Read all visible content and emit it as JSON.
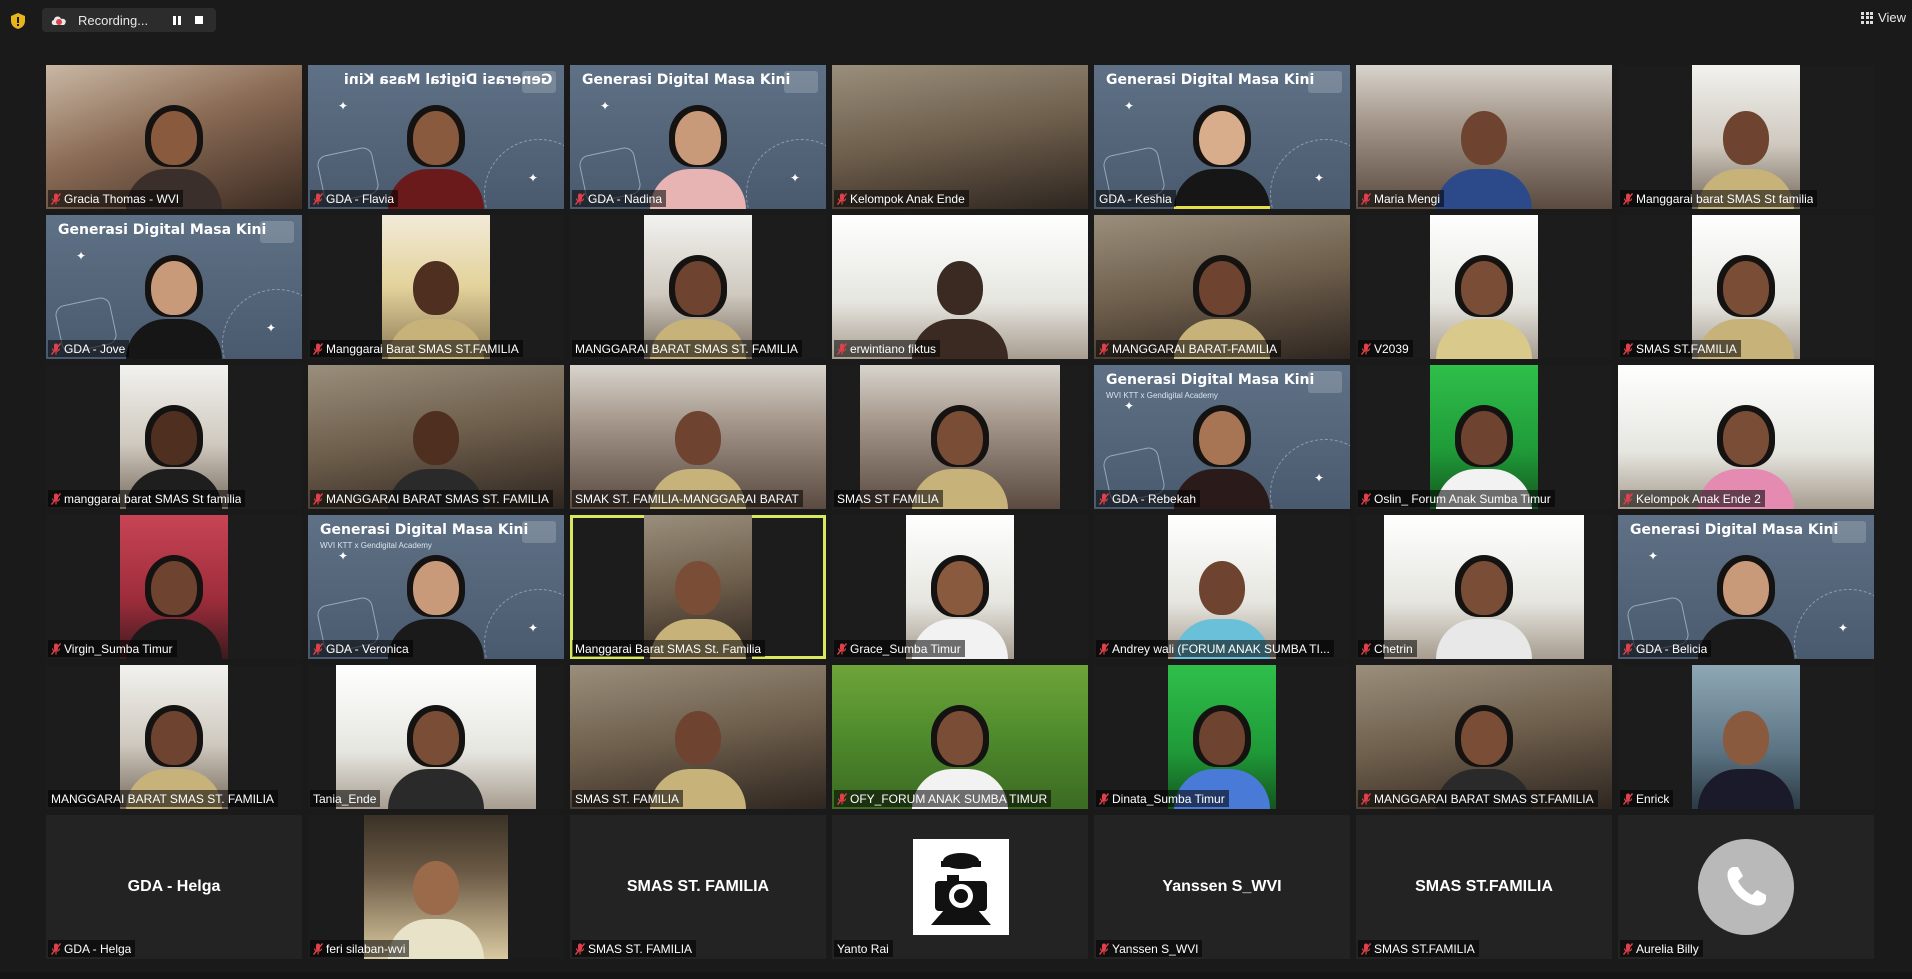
{
  "topbar": {
    "recording_label": "Recording...",
    "view_label": "View"
  },
  "colors": {
    "background": "#1a1a1a",
    "tile": "#1c1c1c",
    "active_speaker": "#d9e85c",
    "muted_icon": "#e0404a",
    "gda_bg": "#56687c"
  },
  "gda_banner": {
    "title": "Generasi Digital Masa Kini",
    "sub": "WVI KTT x Gendigital Academy"
  },
  "tiles": [
    {
      "name": "Gracia Thomas - WVI",
      "muted": true
    },
    {
      "name": "GDA - Flavia",
      "muted": true
    },
    {
      "name": "GDA - Nadina",
      "muted": true
    },
    {
      "name": "Kelompok Anak Ende",
      "muted": true
    },
    {
      "name": "GDA - Keshia",
      "muted": false
    },
    {
      "name": "Maria Mengi",
      "muted": true
    },
    {
      "name": "Manggarai barat SMAS St familia",
      "muted": true
    },
    {
      "name": "GDA - Jove",
      "muted": true
    },
    {
      "name": "Manggarai Barat SMAS ST.FAMILIA",
      "muted": true
    },
    {
      "name": "MANGGARAI BARAT SMAS ST. FAMILIA",
      "muted": false
    },
    {
      "name": "erwintiano fiktus",
      "muted": true
    },
    {
      "name": "MANGGARAI BARAT-FAMILIA",
      "muted": true
    },
    {
      "name": "V2039",
      "muted": true
    },
    {
      "name": "SMAS ST.FAMILIA",
      "muted": true
    },
    {
      "name": "manggarai barat SMAS St familia",
      "muted": true
    },
    {
      "name": "MANGGARAI BARAT SMAS ST. FAMILIA",
      "muted": true
    },
    {
      "name": "SMAK ST. FAMILIA-MANGGARAI BARAT",
      "muted": false
    },
    {
      "name": "SMAS ST FAMILIA",
      "muted": false
    },
    {
      "name": "GDA - Rebekah",
      "muted": true
    },
    {
      "name": "Oslin_ Forum Anak Sumba Timur",
      "muted": true
    },
    {
      "name": "Kelompok Anak Ende 2",
      "muted": true
    },
    {
      "name": "Virgin_Sumba Timur",
      "muted": true
    },
    {
      "name": "GDA - Veronica",
      "muted": true
    },
    {
      "name": "Manggarai Barat SMAS St. Familia",
      "muted": false
    },
    {
      "name": "Grace_Sumba Timur",
      "muted": true
    },
    {
      "name": "Andrey wali (FORUM ANAK SUMBA TI...",
      "muted": true
    },
    {
      "name": "Chetrin",
      "muted": true
    },
    {
      "name": "GDA - Belicia",
      "muted": true
    },
    {
      "name": "MANGGARAI BARAT SMAS ST. FAMILIA",
      "muted": false
    },
    {
      "name": "Tania_Ende",
      "muted": false
    },
    {
      "name": "SMAS ST. FAMILIA",
      "muted": false
    },
    {
      "name": "OFY_FORUM ANAK SUMBA TIMUR",
      "muted": true
    },
    {
      "name": "Dinata_Sumba Timur",
      "muted": true
    },
    {
      "name": "MANGGARAI BARAT SMAS ST.FAMILIA",
      "muted": true
    },
    {
      "name": "Enrick",
      "muted": true
    },
    {
      "name": "GDA - Helga",
      "muted": true,
      "center": "GDA - Helga"
    },
    {
      "name": "feri silaban-wvi",
      "muted": true
    },
    {
      "name": "SMAS ST. FAMILIA",
      "muted": true,
      "center": "SMAS ST. FAMILIA"
    },
    {
      "name": "Yanto Rai",
      "muted": false
    },
    {
      "name": "Yanssen S_WVI",
      "muted": true,
      "center": "Yanssen S_WVI"
    },
    {
      "name": "SMAS ST.FAMILIA",
      "muted": true,
      "center": "SMAS ST.FAMILIA"
    },
    {
      "name": "Aurelia Billy",
      "muted": true
    }
  ]
}
